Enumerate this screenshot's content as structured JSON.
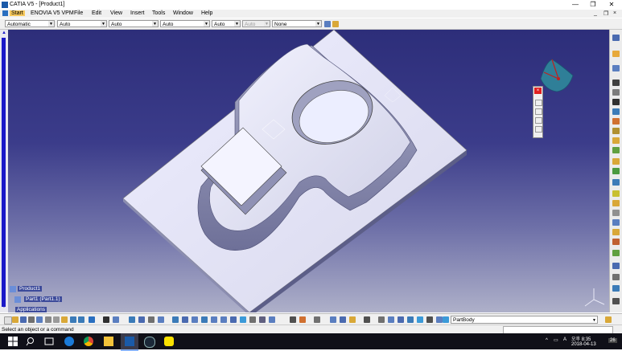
{
  "window": {
    "title": "CATIA V5 - [Product1]",
    "controls": {
      "minimize": "—",
      "restore": "❐",
      "close": "✕"
    }
  },
  "menu": {
    "items": [
      "Start",
      "ENOVIA V5 VPM",
      "File",
      "Edit",
      "View",
      "Insert",
      "Tools",
      "Window",
      "Help"
    ],
    "mdi_controls": {
      "minimize": "_",
      "restore": "❐",
      "close": "×"
    }
  },
  "properties_toolbar": {
    "combos": [
      {
        "value": "Automatic",
        "enabled": true
      },
      {
        "value": "Auto",
        "enabled": true
      },
      {
        "value": "Auto",
        "enabled": true
      },
      {
        "value": "Auto",
        "enabled": true
      },
      {
        "value": "Auto",
        "enabled": true
      },
      {
        "value": "Auto",
        "enabled": false
      },
      {
        "value": "None",
        "enabled": true
      }
    ]
  },
  "tree": {
    "nodes": [
      {
        "label": "Product1"
      },
      {
        "label": "Part1 (Part1.1)"
      },
      {
        "label": "Applications"
      }
    ]
  },
  "workbench": {
    "current_body": "PartBody"
  },
  "status": {
    "message": "Select an object or a command"
  },
  "taskbar": {
    "ime_label": "A",
    "time_prefix": "오후 8:35",
    "date": "2018-04-13",
    "notification_count": "26"
  },
  "icons": {
    "viewport": [
      "compass-icon",
      "axis-triad-icon"
    ],
    "taskbar": [
      "windows-start-icon",
      "search-icon",
      "task-view-icon",
      "edge-icon",
      "chrome-icon",
      "file-explorer-icon",
      "catia-icon",
      "steam-icon",
      "kakaotalk-icon"
    ]
  },
  "colors": {
    "viewport_top": "#2d2e7a",
    "viewport_bottom": "#aeb0c9",
    "start_menu_highlight": "#f7c95d",
    "tree_highlight": "#3c4a9a",
    "scroll_thumb": "#1a18c8"
  }
}
